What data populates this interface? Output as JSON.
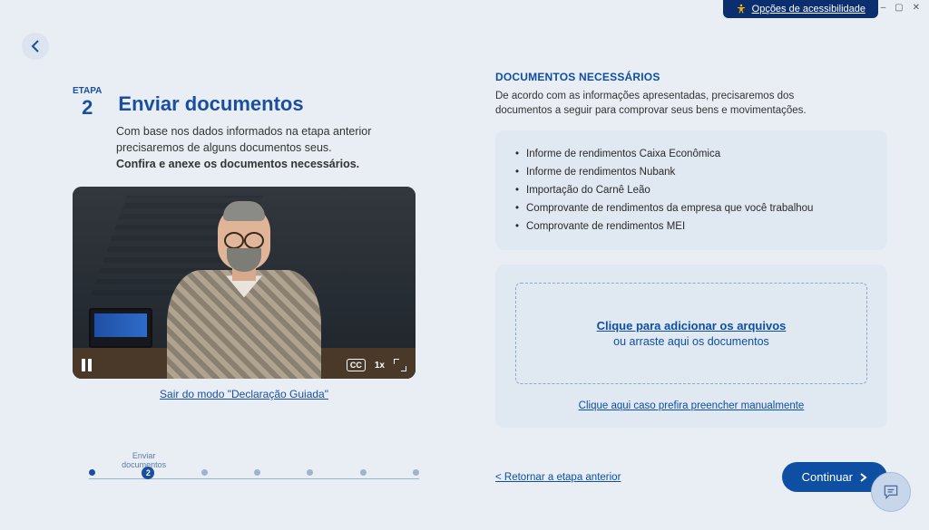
{
  "window": {
    "accessibility_label": "Opções de acessibilidade"
  },
  "left": {
    "step_word": "ETAPA",
    "step_number": "2",
    "title": "Enviar documentos",
    "desc_line1": "Com base nos dados informados na etapa anterior precisaremos de alguns documentos seus.",
    "desc_line2": "Confira e anexe os documentos necessários.",
    "video_speed": "1x",
    "video_cc": "CC",
    "exit_guided": "Sair do modo \"Declaração Guiada\"",
    "stepper": {
      "steps": [
        "",
        "Enviar documentos",
        "",
        "",
        "",
        "",
        ""
      ],
      "current_index": 1,
      "current_label": "Enviar documentos",
      "current_number": "2"
    }
  },
  "right": {
    "section_title": "DOCUMENTOS NECESSÁRIOS",
    "section_sub": "De acordo com as informações apresentadas, precisaremos dos documentos a seguir para comprovar seus bens e movimentações.",
    "documents": [
      "Informe de rendimentos Caixa Econômica",
      "Informe de rendimentos Nubank",
      "Importação do Carnê Leão",
      "Comprovante de rendimentos da empresa que você trabalhou",
      "Comprovante de rendimentos MEI"
    ],
    "dropzone_line1": "Clique para adicionar os arquivos",
    "dropzone_line2": "ou arraste aqui os documentos",
    "manual_link": "Clique aqui caso prefira preencher manualmente",
    "back_link": "< Retornar a etapa anterior",
    "continue_label": "Continuar"
  }
}
